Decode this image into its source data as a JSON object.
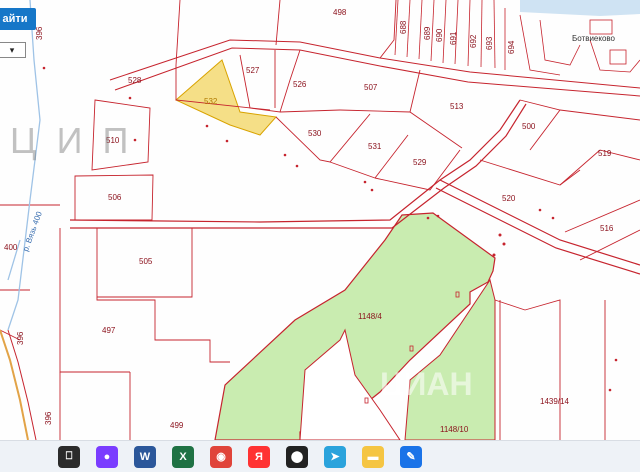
{
  "controls": {
    "find_label": "айти",
    "select_value": ""
  },
  "map": {
    "plots": [
      {
        "id": "p498",
        "label": "498"
      },
      {
        "id": "p688",
        "label": "688"
      },
      {
        "id": "p689",
        "label": "689"
      },
      {
        "id": "p690",
        "label": "690"
      },
      {
        "id": "p691",
        "label": "691"
      },
      {
        "id": "p692",
        "label": "692"
      },
      {
        "id": "p693",
        "label": "693"
      },
      {
        "id": "p694",
        "label": "694"
      },
      {
        "id": "p528",
        "label": "528"
      },
      {
        "id": "p527",
        "label": "527"
      },
      {
        "id": "p526",
        "label": "526"
      },
      {
        "id": "p507",
        "label": "507"
      },
      {
        "id": "p532",
        "label": "532"
      },
      {
        "id": "p513",
        "label": "513"
      },
      {
        "id": "p510",
        "label": "510"
      },
      {
        "id": "p530",
        "label": "530"
      },
      {
        "id": "p531",
        "label": "531"
      },
      {
        "id": "p529",
        "label": "529"
      },
      {
        "id": "p500",
        "label": "500"
      },
      {
        "id": "p519",
        "label": "519"
      },
      {
        "id": "p506",
        "label": "506"
      },
      {
        "id": "p520",
        "label": "520"
      },
      {
        "id": "p516",
        "label": "516"
      },
      {
        "id": "p400",
        "label": "400"
      },
      {
        "id": "p505",
        "label": "505"
      },
      {
        "id": "p1148_4",
        "label": "1148/4"
      },
      {
        "id": "p497",
        "label": "497"
      },
      {
        "id": "p396a",
        "label": "396"
      },
      {
        "id": "p396b",
        "label": "396"
      },
      {
        "id": "p396c",
        "label": "396"
      },
      {
        "id": "p1439_14",
        "label": "1439/14"
      },
      {
        "id": "p499",
        "label": "499"
      },
      {
        "id": "p1148_10",
        "label": "1148/10"
      }
    ],
    "village_label": "Ботвиеково",
    "river_label": "р. Вязь 400",
    "watermark": "ЦИП",
    "watermark2": "ЦИАН"
  },
  "taskbar": {
    "icons": [
      {
        "name": "file-explorer-icon",
        "glyph": "⎕",
        "color": "#2b2b2b"
      },
      {
        "name": "alice-icon",
        "glyph": "●",
        "color": "#7a3cff"
      },
      {
        "name": "word-icon",
        "glyph": "W",
        "color": "#2b579a"
      },
      {
        "name": "excel-icon",
        "glyph": "X",
        "color": "#1f7244"
      },
      {
        "name": "chrome-icon",
        "glyph": "◉",
        "color": "#e0443a"
      },
      {
        "name": "yandex-icon",
        "glyph": "Я",
        "color": "#f33"
      },
      {
        "name": "tor-icon",
        "glyph": "⬤",
        "color": "#222"
      },
      {
        "name": "telegram-icon",
        "glyph": "➤",
        "color": "#2aa3dc"
      },
      {
        "name": "folder-icon",
        "glyph": "▬",
        "color": "#f5c542"
      },
      {
        "name": "paint-icon",
        "glyph": "✎",
        "color": "#1a73e8"
      }
    ]
  }
}
